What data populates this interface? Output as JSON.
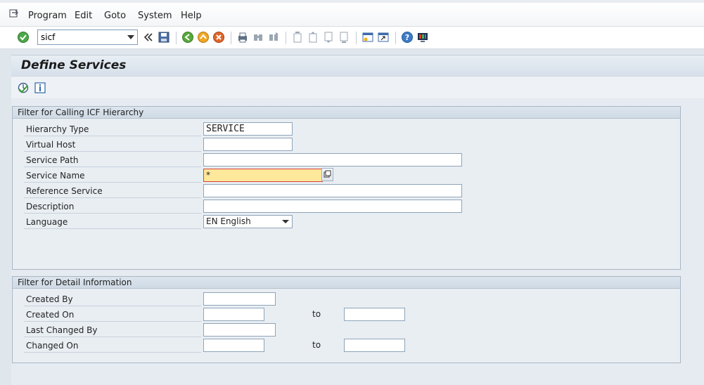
{
  "menubar": {
    "items": [
      {
        "label": "Program"
      },
      {
        "label": "Edit"
      },
      {
        "label": "Goto"
      },
      {
        "label": "System"
      },
      {
        "label": "Help"
      }
    ]
  },
  "toolbar": {
    "command_value": "sicf",
    "icons": [
      "enter-icon",
      "back-double-icon",
      "save-icon",
      "back-icon",
      "exit-icon",
      "cancel-icon",
      "print-icon",
      "find-icon",
      "find-next-icon",
      "first-page-icon",
      "prev-page-icon",
      "next-page-icon",
      "last-page-icon",
      "new-session-icon",
      "shortcut-icon",
      "help-icon",
      "customize-layout-icon"
    ]
  },
  "title": "Define Services",
  "app_toolbar": {
    "icons": [
      "execute-icon",
      "info-icon"
    ]
  },
  "group_hierarchy": {
    "title": "Filter for Calling ICF Hierarchy",
    "fields": [
      {
        "label": "Hierarchy Type",
        "value": "SERVICE"
      },
      {
        "label": "Virtual Host",
        "value": ""
      },
      {
        "label": "Service Path",
        "value": ""
      },
      {
        "label": "Service Name",
        "value": "*"
      },
      {
        "label": "Reference Service",
        "value": ""
      },
      {
        "label": "Description",
        "value": ""
      },
      {
        "label": "Language",
        "value": "EN English"
      }
    ]
  },
  "group_detail": {
    "title": "Filter for Detail Information",
    "to_label": "to",
    "fields": [
      {
        "label": "Created By",
        "value": ""
      },
      {
        "label": "Created On",
        "value": "",
        "to_value": ""
      },
      {
        "label": "Last Changed By",
        "value": ""
      },
      {
        "label": "Changed On",
        "value": "",
        "to_value": ""
      }
    ]
  },
  "colors": {
    "focus_field": "#fde89b",
    "focus_border": "#d8403a",
    "header_bg": "#d6e0ea",
    "panel_bg": "#e9eef3"
  }
}
